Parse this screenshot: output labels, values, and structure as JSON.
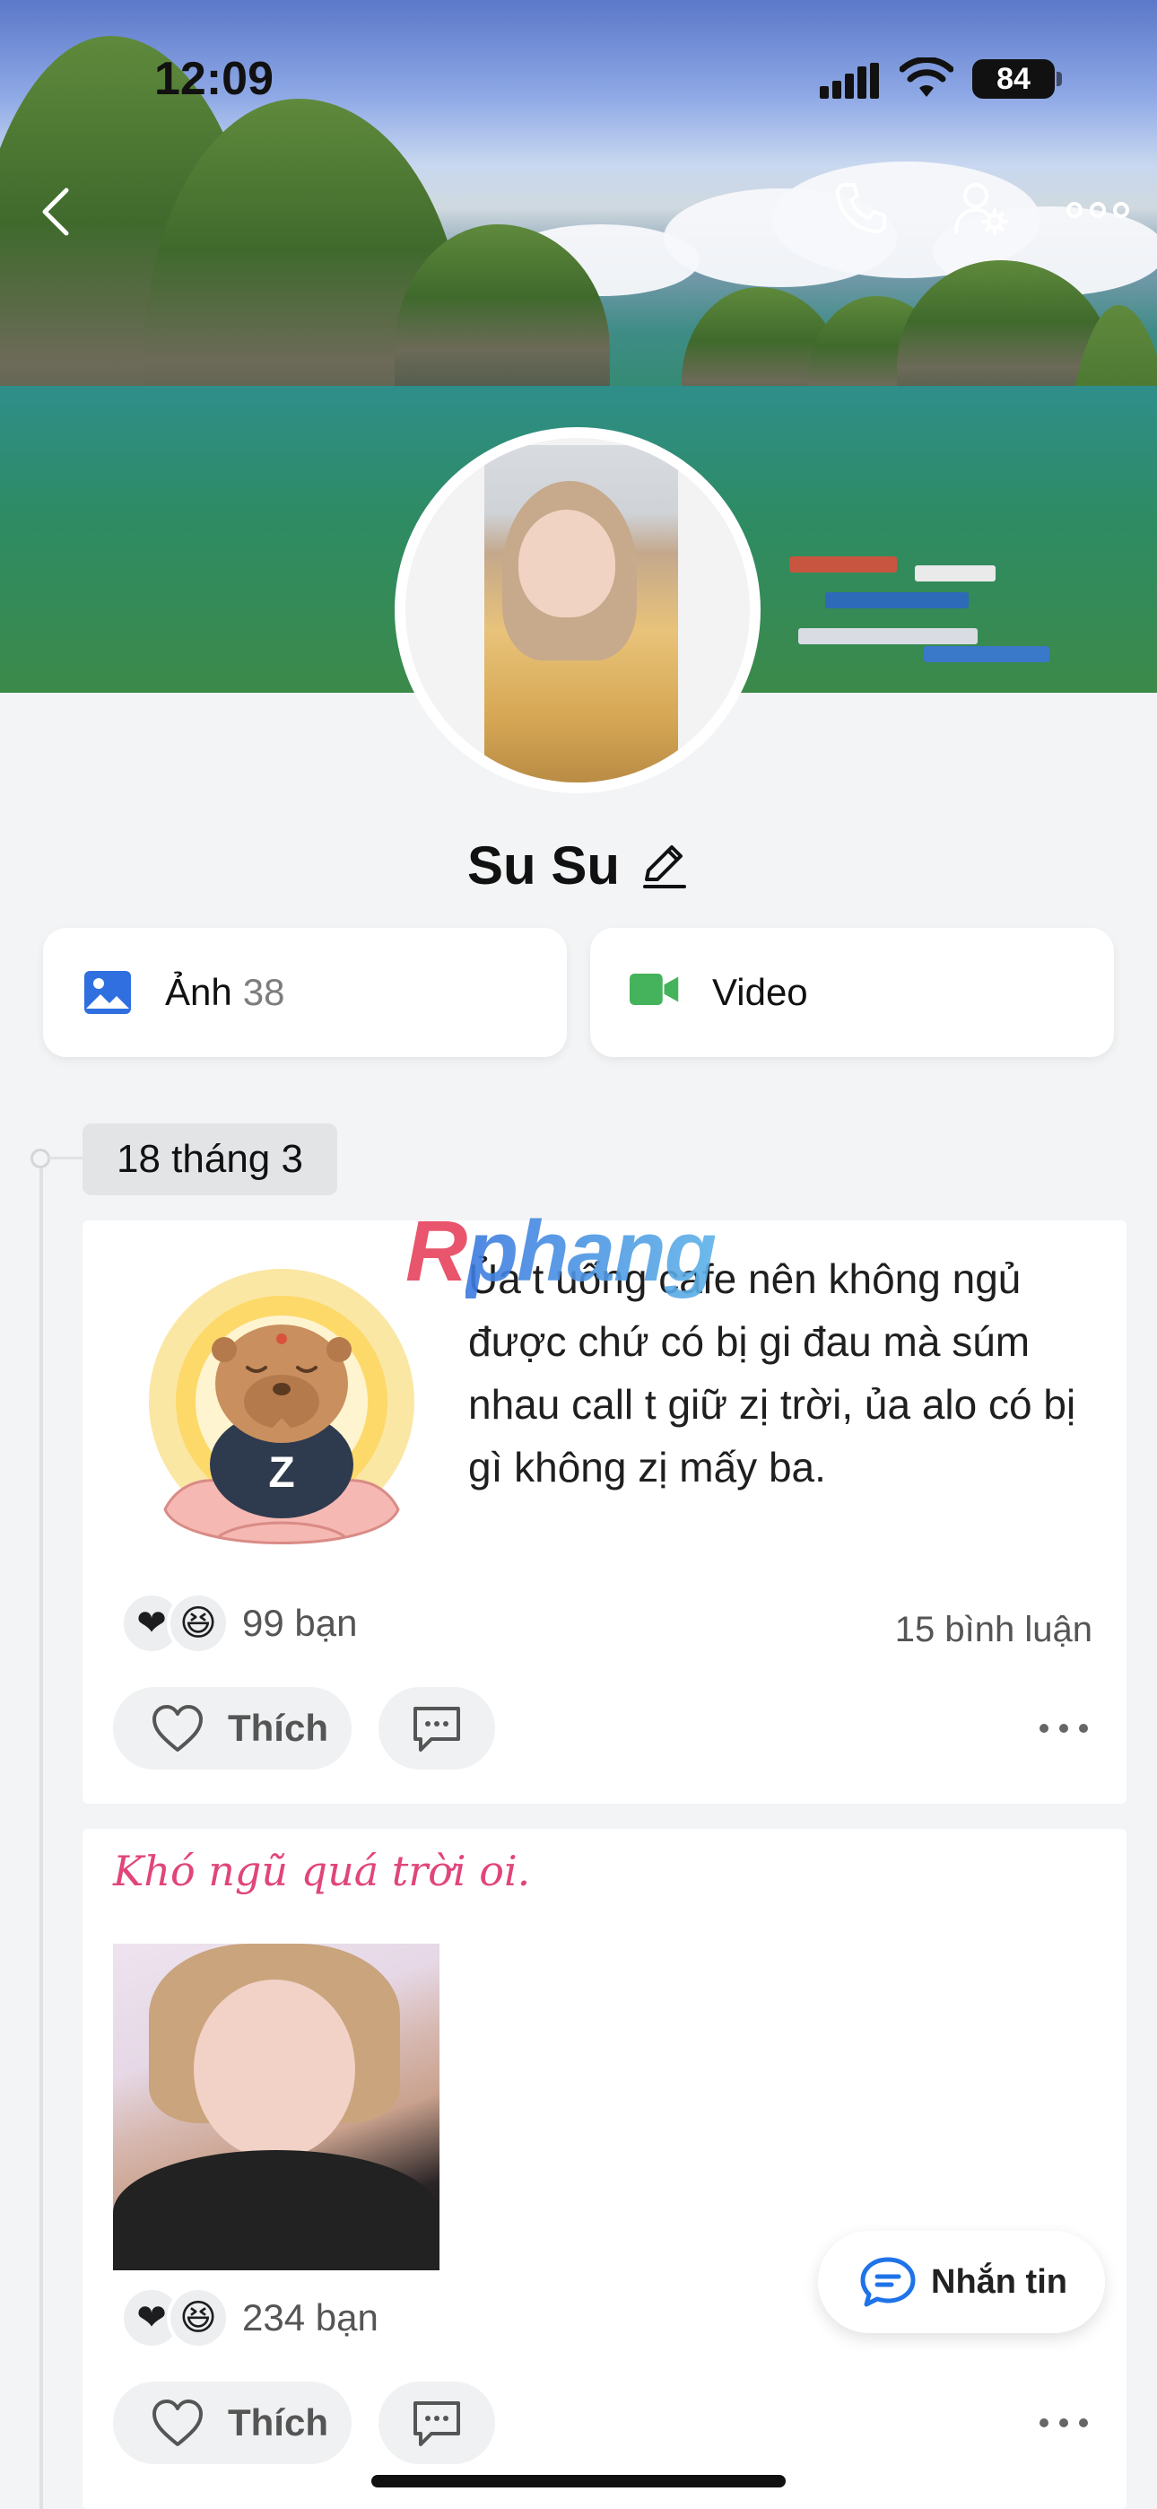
{
  "status_bar": {
    "time": "12:09",
    "battery": "84"
  },
  "profile": {
    "name": "Su Su"
  },
  "media": {
    "photos_label": "Ảnh",
    "photos_count": "38",
    "video_label": "Video"
  },
  "timeline": {
    "date": "18 tháng 3"
  },
  "watermark": {
    "first": "R",
    "rest": "phang"
  },
  "posts": [
    {
      "text": "Ủa t uống cafe nên không ngủ được chứ có bị gi đau mà súm nhau call t giữ zị trời, ủa alo có bị gì không zị mấy ba.",
      "reactions_count": "99 bạn",
      "comments_count": "15 bình luận",
      "like_label": "Thích"
    },
    {
      "caption": "Khó ngũ quá trời oi.",
      "reactions_count": "234 bạn",
      "like_label": "Thích"
    }
  ],
  "message_button": {
    "label": "Nhắn tin"
  },
  "colors": {
    "caption_pink": "#e0457b",
    "photo_blue": "#2f6fe0",
    "video_green": "#45b35c",
    "message_blue": "#1f73e8"
  },
  "icons": [
    "back-icon",
    "phone-icon",
    "profile-settings-icon",
    "more-icon",
    "edit-icon",
    "photo-icon",
    "video-icon",
    "heart-icon",
    "comment-icon",
    "message-icon"
  ]
}
